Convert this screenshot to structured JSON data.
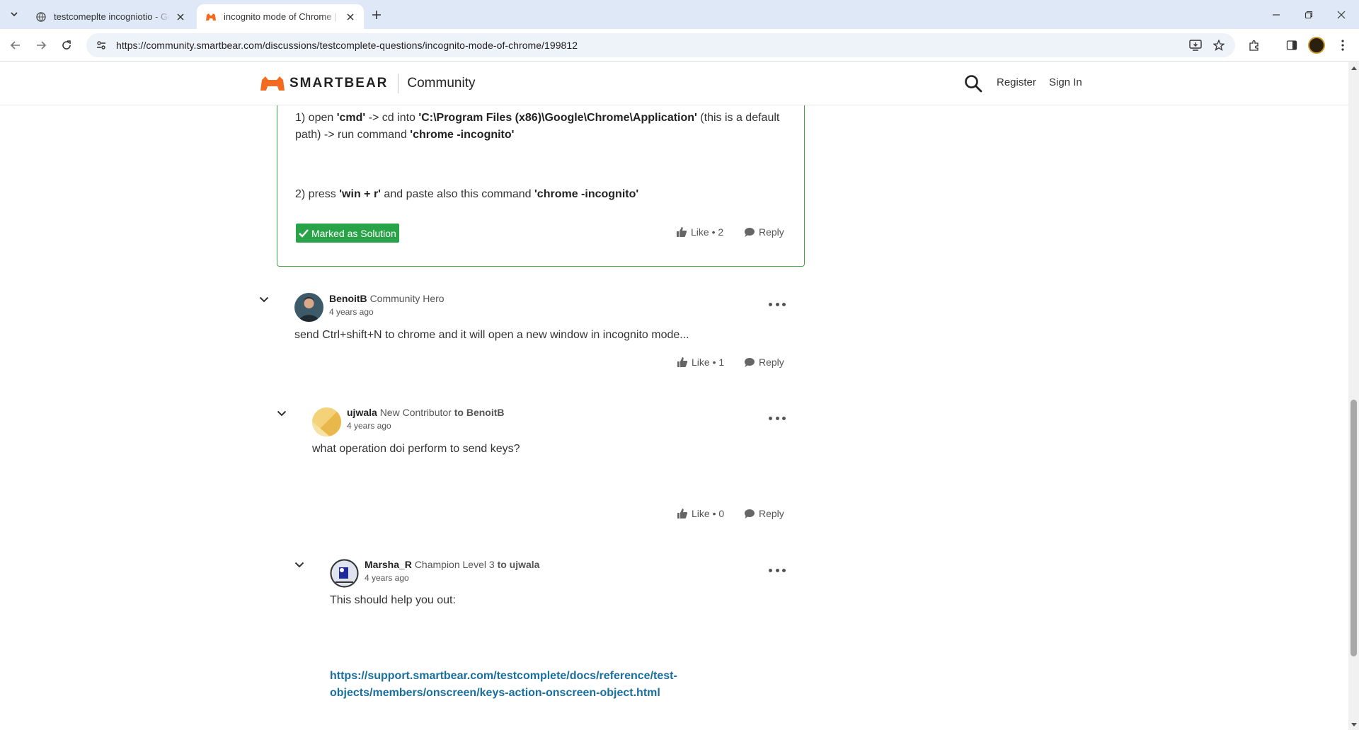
{
  "browser": {
    "tabs": [
      {
        "title": "testcomeplte incogniotio - Goo",
        "active": false
      },
      {
        "title": "incognito mode of Chrome | Sm",
        "active": true
      }
    ],
    "url": "https://community.smartbear.com/discussions/testcomplete-questions/incognito-mode-of-chrome/199812"
  },
  "header": {
    "brand": "SMARTBEAR",
    "section": "Community",
    "register": "Register",
    "signin": "Sign In"
  },
  "solution_post": {
    "line1_pre": "1) open ",
    "line1_cmd": "'cmd'",
    "line1_mid": " -> cd into ",
    "line1_path": "'C:\\Program Files (x86)\\Google\\Chrome\\Application'",
    "line1_post": " (this is a default path) -> run command ",
    "line1_cmd2": "'chrome -incognito'",
    "line2_pre": "2) press ",
    "line2_keys": "'win + r'",
    "line2_mid": " and paste also this command ",
    "line2_cmd": "'chrome -incognito'",
    "badge": "Marked as Solution",
    "like": "Like • 2",
    "reply": "Reply"
  },
  "replies": [
    {
      "username": "BenoitB",
      "rank": "Community Hero",
      "to_label": "",
      "time": "4 years ago",
      "body": "send Ctrl+shift+N to chrome and it will open a new window in incognito mode...",
      "like": "Like • 1",
      "reply": "Reply"
    },
    {
      "username": "ujwala",
      "rank": "New Contributor",
      "to_label": "to BenoitB",
      "time": "4 years ago",
      "body": "what operation doi perform to send keys?",
      "like": "Like • 0",
      "reply": "Reply"
    },
    {
      "username": "Marsha_R",
      "rank": "Champion Level 3",
      "to_label": "to ujwala",
      "time": "4 years ago",
      "body": "This should help you out:",
      "link_line1": "https://support.smartbear.com/testcomplete/docs/reference/test-",
      "link_line2": "objects/members/onscreen/keys-action-onscreen-object.html"
    }
  ],
  "colors": {
    "solution_green": "#29a347",
    "link_blue": "#1a6f9e",
    "brand_orange": "#f26b21"
  }
}
